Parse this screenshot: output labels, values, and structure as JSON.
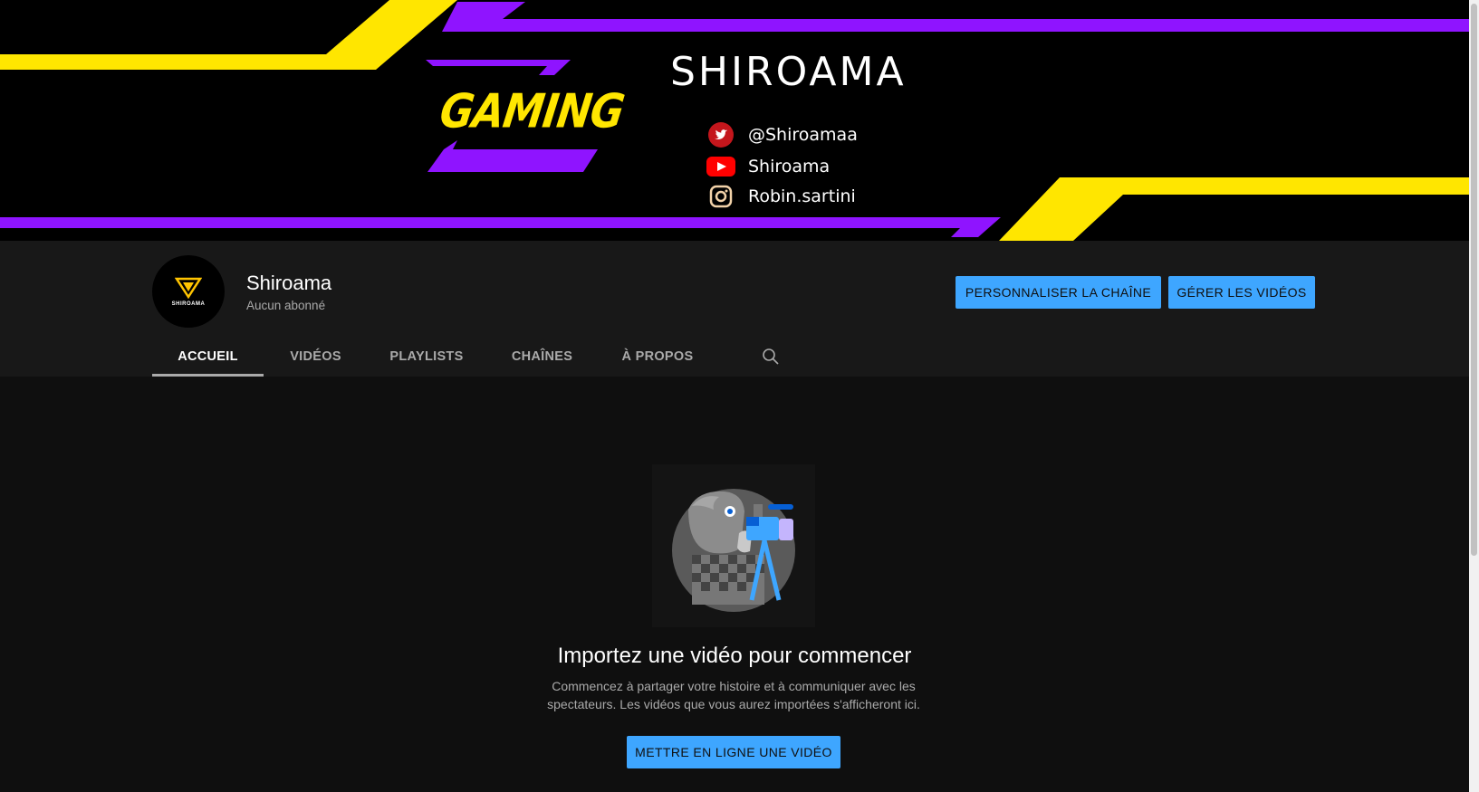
{
  "banner": {
    "title": "SHIROAMA",
    "badge": "GAMING",
    "socials": [
      {
        "icon": "twitter-icon",
        "text": "@Shiroamaa"
      },
      {
        "icon": "youtube-icon",
        "text": "Shiroama"
      },
      {
        "icon": "instagram-icon",
        "text": "Robin.sartini"
      }
    ],
    "colors": {
      "yellow": "#ffe600",
      "purple": "#8f14ff",
      "background": "#000000"
    }
  },
  "channel": {
    "name": "Shiroama",
    "subscribers": "Aucun abonné",
    "avatar_text": "SHIROAMA"
  },
  "actions": {
    "customize_label": "PERSONNALISER LA CHAÎNE",
    "manage_label": "GÉRER LES VIDÉOS"
  },
  "tabs": [
    {
      "label": "ACCUEIL",
      "active": true
    },
    {
      "label": "VIDÉOS",
      "active": false
    },
    {
      "label": "PLAYLISTS",
      "active": false
    },
    {
      "label": "CHAÎNES",
      "active": false
    },
    {
      "label": "À PROPOS",
      "active": false
    }
  ],
  "empty_state": {
    "title": "Importez une vidéo pour commencer",
    "description": "Commencez à partager votre histoire et à communiquer avec les spectateurs. Les vidéos que vous aurez importées s'afficheront ici.",
    "button_label": "METTRE EN LIGNE UNE VIDÉO"
  },
  "theme": {
    "accent": "#3ea6ff",
    "background": "#0f0f0f",
    "header_bg": "#181818"
  }
}
